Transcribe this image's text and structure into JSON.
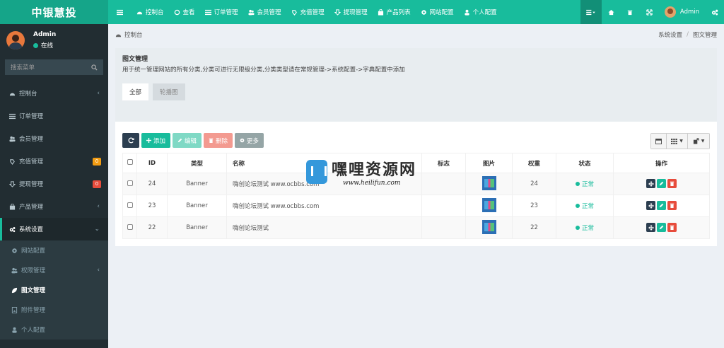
{
  "brand": "中银慧投",
  "topnav": [
    {
      "label": "控制台",
      "icon": "dashboard-icon"
    },
    {
      "label": "查看",
      "icon": "circle-icon"
    },
    {
      "label": "订单管理",
      "icon": "list-icon"
    },
    {
      "label": "会员管理",
      "icon": "users-icon"
    },
    {
      "label": "充值管理",
      "icon": "recharge-icon"
    },
    {
      "label": "提现管理",
      "icon": "withdraw-icon"
    },
    {
      "label": "产品列表",
      "icon": "bag-icon"
    },
    {
      "label": "网站配置",
      "icon": "gear-icon"
    },
    {
      "label": "个人配置",
      "icon": "user-icon"
    }
  ],
  "topuser": "Admin",
  "sidebar": {
    "user_name": "Admin",
    "user_status": "在线",
    "search_placeholder": "搜索菜单",
    "items": [
      {
        "label": "控制台"
      },
      {
        "label": "订单管理"
      },
      {
        "label": "会员管理"
      },
      {
        "label": "充值管理",
        "badge": "0"
      },
      {
        "label": "提现管理",
        "badge": "0"
      },
      {
        "label": "产品管理"
      },
      {
        "label": "系统设置"
      }
    ],
    "sub_items": [
      {
        "label": "网站配置"
      },
      {
        "label": "权限管理"
      },
      {
        "label": "图文管理"
      },
      {
        "label": "附件管理"
      },
      {
        "label": "个人配置"
      }
    ]
  },
  "breadcrumb": {
    "left": "控制台",
    "right": [
      "系统设置",
      "图文管理"
    ]
  },
  "panel": {
    "title": "图文管理",
    "desc": "用于统一管理网站的所有分类,分类可进行无限级分类,分类类型请在常规管理->系统配置->字典配置中添加",
    "tabs": [
      "全部",
      "轮播图"
    ]
  },
  "toolbar": {
    "add": "添加",
    "edit": "编辑",
    "delete": "删除",
    "more": "更多"
  },
  "table": {
    "headers": [
      "ID",
      "类型",
      "名称",
      "标志",
      "图片",
      "权重",
      "状态",
      "操作"
    ],
    "rows": [
      {
        "id": "24",
        "type": "Banner",
        "name": "嗨创论坛测试 www.ocbbs.com",
        "flag": "",
        "weight": "24",
        "status": "正常"
      },
      {
        "id": "23",
        "type": "Banner",
        "name": "嗨创论坛测试 www.ocbbs.com",
        "flag": "",
        "weight": "23",
        "status": "正常"
      },
      {
        "id": "22",
        "type": "Banner",
        "name": "嗨创论坛测试",
        "flag": "",
        "weight": "22",
        "status": "正常"
      }
    ]
  },
  "watermark": {
    "title": "嘿哩资源网",
    "url": "www.heilifun.com"
  },
  "colors": {
    "primary": "#18bc9c",
    "sidebar": "#222d32",
    "danger": "#e74c3c",
    "warning": "#f39c12"
  }
}
